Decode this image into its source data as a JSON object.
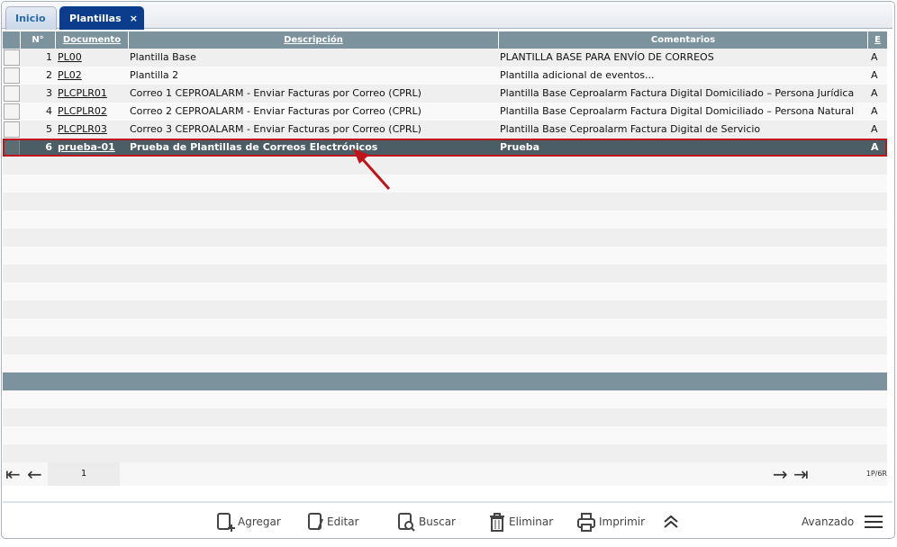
{
  "tabs": [
    {
      "label": "Inicio"
    },
    {
      "label": "Plantillas",
      "close": "×"
    }
  ],
  "columns": {
    "num": "N°",
    "doc": "Documento",
    "desc": "Descripción",
    "com": "Comentarios",
    "e": "E"
  },
  "rows": [
    {
      "n": "1",
      "doc": "PL00",
      "desc": "Plantilla Base",
      "com": "PLANTILLA BASE PARA ENVÍO DE CORREOS",
      "e": "A"
    },
    {
      "n": "2",
      "doc": "PL02",
      "desc": "Plantilla 2",
      "com": "Plantilla adicional de eventos...",
      "e": "A"
    },
    {
      "n": "3",
      "doc": "PLCPLR01",
      "desc": "Correo 1 CEPROALARM - Enviar Facturas por Correo (CPRL)",
      "com": "Plantilla Base Ceproalarm Factura Digital Domiciliado – Persona Jurídica",
      "e": "A"
    },
    {
      "n": "4",
      "doc": "PLCPLR02",
      "desc": "Correo 2 CEPROALARM - Enviar Facturas por Correo (CPRL)",
      "com": "Plantilla Base Ceproalarm Factura Digital Domiciliado – Persona Natural",
      "e": "A"
    },
    {
      "n": "5",
      "doc": "PLCPLR03",
      "desc": "Correo 3 CEPROALARM - Enviar Facturas por Correo (CPRL)",
      "com": "Plantilla Base Ceproalarm Factura Digital de Servicio",
      "e": "A"
    },
    {
      "n": "6",
      "doc": "prueba-01",
      "desc": "Prueba de Plantillas de Correos Electrónicos",
      "com": "Prueba",
      "e": "A"
    }
  ],
  "pager": {
    "page": "1",
    "count": "1P/6R"
  },
  "toolbar": {
    "add": "Agregar",
    "edit": "Editar",
    "search": "Buscar",
    "delete": "Eliminar",
    "print": "Imprimir",
    "advanced": "Avanzado"
  }
}
